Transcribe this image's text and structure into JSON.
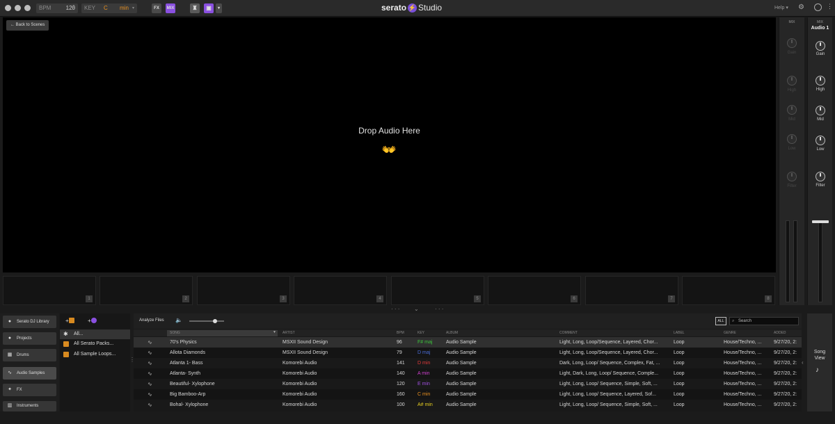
{
  "topbar": {
    "bpm_label": "BPM",
    "bpm_value": "120",
    "key_label": "KEY",
    "key_value": "C",
    "key_mode": "min",
    "fx_label": "FX",
    "mix_label": "MIX",
    "logo_text": "serato",
    "logo_studio": "Studio",
    "help_label": "Help"
  },
  "stage": {
    "back_label": "Back to Scenes",
    "drop_text": "Drop Audio Here",
    "hands_glyph": "👐"
  },
  "pads": [
    "1",
    "2",
    "3",
    "4",
    "5",
    "6",
    "7",
    "8"
  ],
  "mixer": {
    "master_header": "MIX",
    "master_knobs": [
      "Gain",
      "High",
      "Mid",
      "Low",
      "Filter"
    ],
    "channel_header": "MIX",
    "channel_title": "Audio 1",
    "channel_knobs": [
      "Gain",
      "High",
      "Mid",
      "Low",
      "Filter"
    ]
  },
  "sidebar": {
    "items": [
      {
        "label": "Serato DJ Library",
        "icon": "serato-icon"
      },
      {
        "label": "Projects",
        "icon": "serato-icon"
      },
      {
        "label": "Drums",
        "icon": "drums-icon"
      },
      {
        "label": "Audio Samples",
        "icon": "waveform-icon"
      },
      {
        "label": "FX",
        "icon": "fx-icon"
      },
      {
        "label": "Instruments",
        "icon": "keys-icon"
      }
    ]
  },
  "crates": {
    "items": [
      {
        "label": "All..."
      },
      {
        "label": "All Serato Packs..."
      },
      {
        "label": "All Sample Loops..."
      }
    ]
  },
  "table": {
    "analyze_label": "Analyze Files",
    "all_badge": "ALL",
    "search_placeholder": "Search",
    "columns": [
      "SONG",
      "ARTIST",
      "BPM",
      "KEY",
      "ALBUM",
      "COMMENT",
      "LABEL",
      "GENRE",
      "ADDED"
    ],
    "rows": [
      {
        "song": "70's Physics",
        "artist": "MSXII Sound Design",
        "bpm": "96",
        "key": "F# maj",
        "key_color": "#3cc43c",
        "album": "Audio Sample",
        "comment": "Light, Long, Loop/Sequence, Layered, Chor...",
        "label": "Loop",
        "genre": "House/Techno, ...",
        "added": "9/27/20, 2:"
      },
      {
        "song": "Allota Diamonds",
        "artist": "MSXII Sound Design",
        "bpm": "79",
        "key": "D maj",
        "key_color": "#4a6cd8",
        "album": "Audio Sample",
        "comment": "Light, Long, Loop/Sequence, Layered, Chor...",
        "label": "Loop",
        "genre": "House/Techno, ...",
        "added": "9/27/20, 2:"
      },
      {
        "song": "Atlanta 1- Bass",
        "artist": "Komorebi Audio",
        "bpm": "141",
        "key": "D min",
        "key_color": "#e23a3a",
        "album": "Audio Sample",
        "comment": "Dark, Long, Loop/ Sequence, Complex, Fat, ...",
        "label": "Loop",
        "genre": "House/Techno, ...",
        "added": "9/27/20, 2:"
      },
      {
        "song": "Atlanta- Synth",
        "artist": "Komorebi Audio",
        "bpm": "140",
        "key": "A min",
        "key_color": "#d040d0",
        "album": "Audio Sample",
        "comment": "Light, Dark, Long, Loop/ Sequence, Comple...",
        "label": "Loop",
        "genre": "House/Techno, ...",
        "added": "9/27/20, 2:"
      },
      {
        "song": "Beautiful- Xylophone",
        "artist": "Komorebi Audio",
        "bpm": "120",
        "key": "E min",
        "key_color": "#a050e0",
        "album": "Audio Sample",
        "comment": "Light, Long, Loop/ Sequence, Simple, Soft, ...",
        "label": "Loop",
        "genre": "House/Techno, ...",
        "added": "9/27/20, 2:"
      },
      {
        "song": "Big Bamboo-Arp",
        "artist": "Komorebi Audio",
        "bpm": "160",
        "key": "C min",
        "key_color": "#e89020",
        "album": "Audio Sample",
        "comment": "Light, Long, Loop/ Sequence, Layered, Sof...",
        "label": "Loop",
        "genre": "House/Techno, ...",
        "added": "9/27/20, 2:"
      },
      {
        "song": "Bohal- Xylophone",
        "artist": "Komorebi Audio",
        "bpm": "100",
        "key": "A# min",
        "key_color": "#e8d020",
        "album": "Audio Sample",
        "comment": "Light, Long, Loop/ Sequence, Simple, Soft, ...",
        "label": "Loop",
        "genre": "House/Techno, ...",
        "added": "9/27/20, 2:"
      }
    ]
  },
  "songview": {
    "label_line1": "Song",
    "label_line2": "View"
  }
}
